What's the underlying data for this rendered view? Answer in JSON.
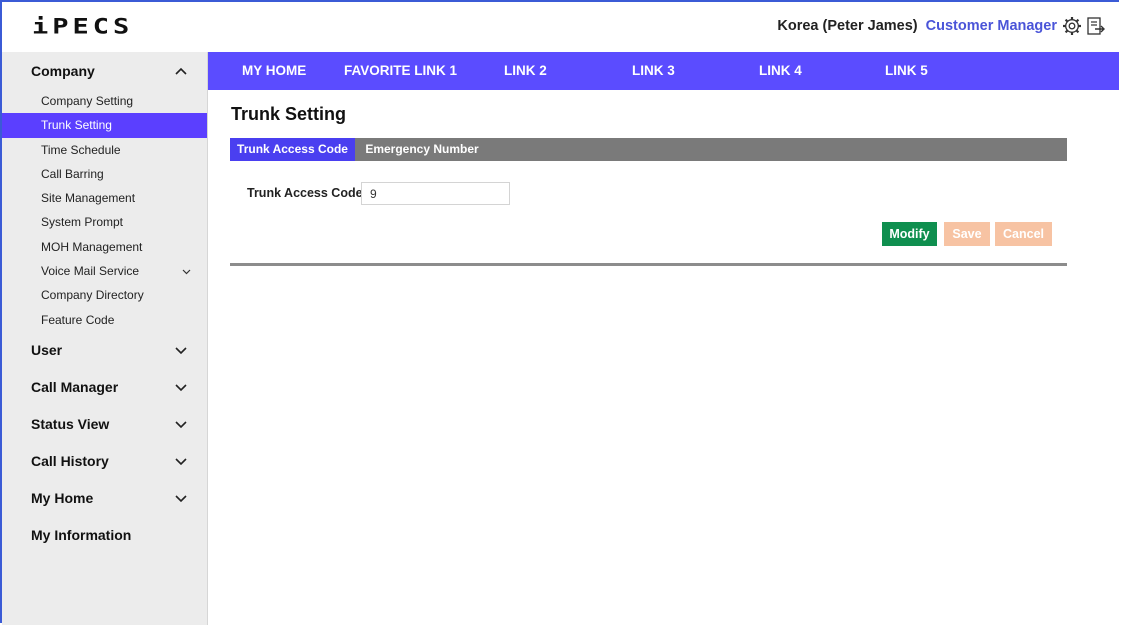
{
  "header": {
    "logo_text": "iPECS",
    "company": "Korea (Peter James)",
    "role": "Customer Manager",
    "settings_icon": "gear-icon",
    "logout_icon": "logout-icon"
  },
  "sidebar": {
    "groups": [
      {
        "label": "Company",
        "expanded": true,
        "items": [
          {
            "label": "Company Setting",
            "active": false
          },
          {
            "label": "Trunk Setting",
            "active": true
          },
          {
            "label": "Time Schedule",
            "active": false
          },
          {
            "label": "Call Barring",
            "active": false
          },
          {
            "label": "Site Management",
            "active": false
          },
          {
            "label": "System Prompt",
            "active": false
          },
          {
            "label": "MOH Management",
            "active": false
          },
          {
            "label": "Voice Mail Service",
            "active": false,
            "has_children": true
          },
          {
            "label": "Company Directory",
            "active": false
          },
          {
            "label": "Feature Code",
            "active": false
          }
        ]
      },
      {
        "label": "User",
        "expanded": false
      },
      {
        "label": "Call Manager",
        "expanded": false
      },
      {
        "label": "Status View",
        "expanded": false
      },
      {
        "label": "Call History",
        "expanded": false
      },
      {
        "label": "My Home",
        "expanded": false
      },
      {
        "label": "My Information",
        "expanded": false
      }
    ]
  },
  "topnav": {
    "items": [
      "MY HOME",
      "FAVORITE LINK 1",
      "LINK 2",
      "LINK 3",
      "LINK 4",
      "LINK 5"
    ]
  },
  "main": {
    "title": "Trunk Setting",
    "tabs": [
      {
        "label": "Trunk Access Code",
        "active": true
      },
      {
        "label": "Emergency Number",
        "active": false
      }
    ],
    "form": {
      "trunk_access_code_label": "Trunk Access Code",
      "required_mark": "*",
      "trunk_access_code_value": "9"
    },
    "buttons": {
      "modify": "Modify",
      "save": "Save",
      "cancel": "Cancel"
    }
  },
  "colors": {
    "accent": "#5b4cff",
    "active_item": "#5b3fff",
    "modify_button": "#0f8f4f",
    "disabled_button": "#f7c3a3",
    "tabbar": "#7a7a7a",
    "role_text": "#4a54d8"
  }
}
